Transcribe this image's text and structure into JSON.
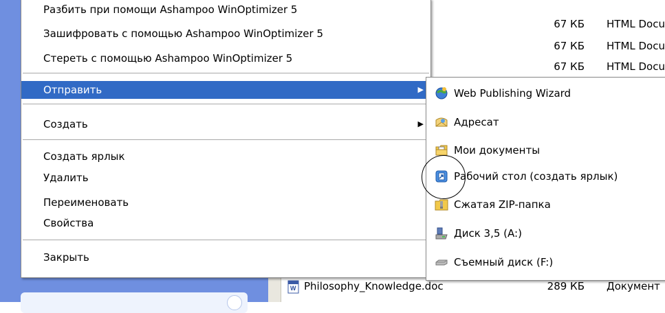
{
  "files": [
    {
      "size": "67 КБ",
      "type": "HTML Docu"
    },
    {
      "size": "67 КБ",
      "type": "HTML Docu"
    },
    {
      "size": "67 КБ",
      "type": "HTML Docu"
    },
    {
      "name": "Philosophy_Knowledge.doc",
      "size": "289 КБ",
      "type": "Документ"
    }
  ],
  "context_menu": {
    "items": [
      {
        "label": "Разбить при помощи Ashampoo WinOptimizer 5"
      },
      {
        "label": "Зашифровать с помощью Ashampoo WinOptimizer 5"
      },
      {
        "label": "Стереть с помощью Ashampoo WinOptimizer 5"
      },
      {
        "label": "Отправить",
        "arrow": "▶"
      },
      {
        "label": "Создать",
        "arrow": "▶"
      },
      {
        "label": "Создать ярлык"
      },
      {
        "label": "Удалить"
      },
      {
        "label": "Переименовать"
      },
      {
        "label": "Свойства"
      },
      {
        "label": "Закрыть"
      }
    ]
  },
  "send_to_menu": {
    "items": [
      {
        "label": "Web Publishing Wizard",
        "icon": "web-publishing-wizard-icon"
      },
      {
        "label": "Адресат",
        "icon": "mail-recipient-icon"
      },
      {
        "label": "Мои документы",
        "icon": "my-documents-icon"
      },
      {
        "label": "Рабочий стол (создать ярлык)",
        "icon": "desktop-shortcut-icon"
      },
      {
        "label": "Сжатая ZIP-папка",
        "icon": "zip-folder-icon"
      },
      {
        "label": "Диск 3,5 (A:)",
        "icon": "floppy-drive-icon"
      },
      {
        "label": "Съемный диск (F:)",
        "icon": "removable-disk-icon"
      }
    ]
  },
  "colors": {
    "selection": "#316ac5",
    "taskpane": "#6f8fe0"
  }
}
